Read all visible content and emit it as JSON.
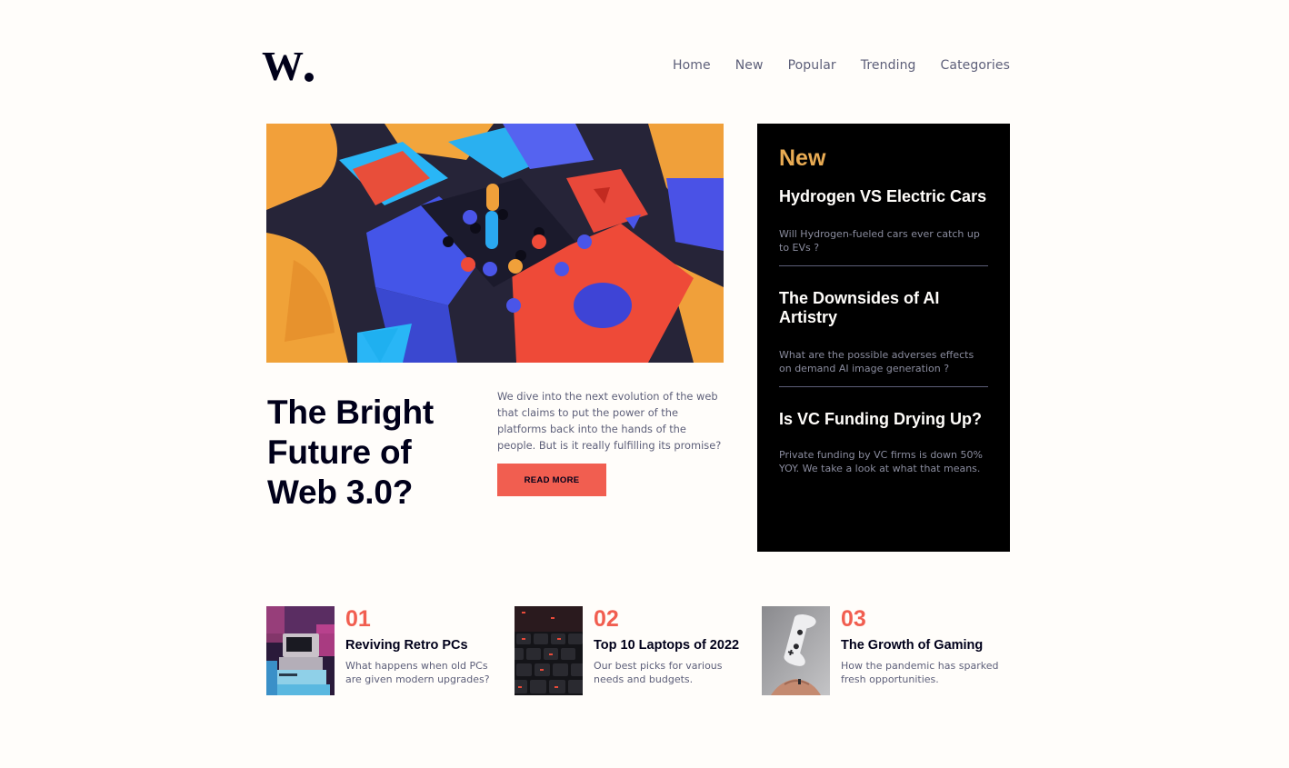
{
  "brand": {
    "logo_text": "W."
  },
  "nav": {
    "items": [
      "Home",
      "New",
      "Popular",
      "Trending",
      "Categories"
    ]
  },
  "hero": {
    "title": "The Bright Future of Web 3.0?",
    "description": "We dive into the next evolution of the web that claims to put the power of the platforms back into the hands of the people. But is it really fulfilling its promise?",
    "button_label": "READ MORE"
  },
  "new_panel": {
    "heading": "New",
    "items": [
      {
        "title": "Hydrogen VS Electric Cars",
        "description": "Will Hydrogen-fueled cars ever catch up to EVs ?"
      },
      {
        "title": "The Downsides of AI Artistry",
        "description": "What are the possible adverses effects on demand AI image generation ?"
      },
      {
        "title": "Is VC Funding Drying Up?",
        "description": "Private funding by VC firms is down 50% YOY. We take a look at what that means."
      }
    ]
  },
  "cards": [
    {
      "number": "01",
      "title": "Reviving Retro PCs",
      "description": "What happens when old PCs are given modern upgrades?"
    },
    {
      "number": "02",
      "title": "Top 10 Laptops of 2022",
      "description": "Our best picks for various needs and budgets."
    },
    {
      "number": "03",
      "title": "The Growth of Gaming",
      "description": "How the pandemic has sparked fresh opportunities."
    }
  ],
  "colors": {
    "background": "#fffdfa",
    "accent_red": "#f15e50",
    "accent_orange": "#e9ab53",
    "dark": "#00001a",
    "grey": "#5d5f79"
  }
}
